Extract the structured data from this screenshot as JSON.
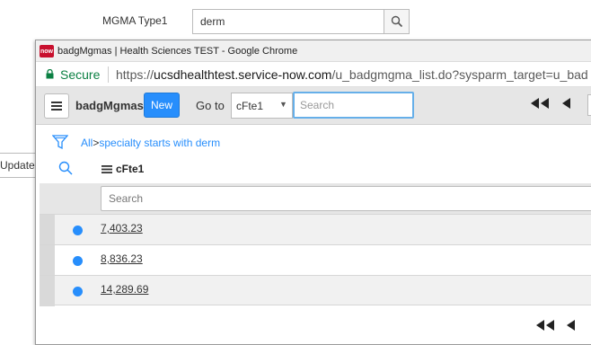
{
  "background_form": {
    "label": "MGMA Type1",
    "input_value": "derm",
    "update_button": "Update"
  },
  "window": {
    "logo_text": "now",
    "title": "badgMgmas | Health Sciences TEST - Google Chrome"
  },
  "address_bar": {
    "secure_label": "Secure",
    "url_scheme": "https://",
    "url_host": "ucsdhealthtest.service-now.com",
    "url_path": "/u_badgmgma_list.do?sysparm_target=u_bad"
  },
  "list_header": {
    "title": "badgMgmas",
    "new_button": "New",
    "goto_label": "Go to",
    "goto_field": "cFte1",
    "search_placeholder": "Search"
  },
  "breadcrumb": {
    "all": "All",
    "separator": ">",
    "condition": "specialty starts with derm"
  },
  "table": {
    "column": "cFte1",
    "column_search_placeholder": "Search",
    "rows": [
      {
        "value": "7,403.23"
      },
      {
        "value": "8,836.23"
      },
      {
        "value": "14,289.69"
      }
    ]
  },
  "colors": {
    "accent": "#278efc",
    "secure_green": "#0b8043",
    "logo_red": "#c8102e"
  },
  "icons": [
    "search-icon",
    "lock-icon",
    "hamburger-icon",
    "filter-icon",
    "first-page-icon",
    "previous-page-icon"
  ]
}
